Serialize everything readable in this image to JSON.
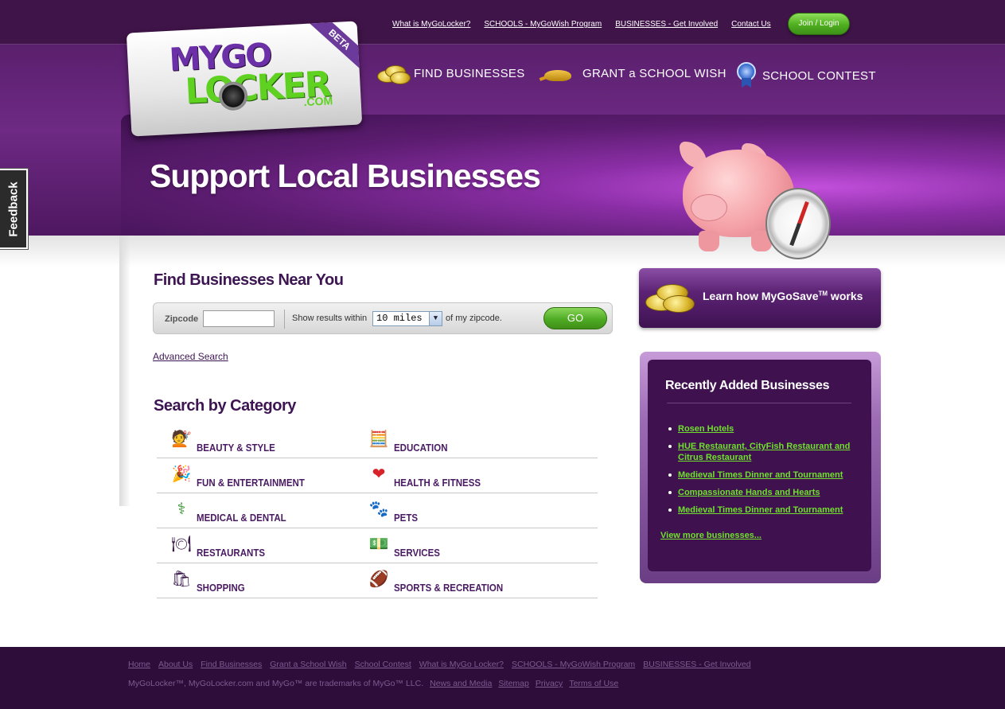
{
  "top_links": [
    "What is MyGoLocker?",
    "SCHOOLS - MyGoWish Program",
    "BUSINESSES - Get Involved",
    "Contact Us"
  ],
  "join_label": "Join / Login",
  "logo": {
    "line1": "MYGO",
    "line2": "LOCKER",
    "tld": ".COM",
    "badge": "BETA"
  },
  "main_nav": [
    {
      "label": "FIND BUSINESSES",
      "icon": "gold-coins-icon"
    },
    {
      "label": "GRANT a SCHOOL WISH",
      "icon": "magic-lamp-icon"
    },
    {
      "label": "SCHOOL CONTEST",
      "icon": "award-ribbon-icon"
    }
  ],
  "hero_title": "Support Local Businesses",
  "feedback_label": "Feedback",
  "search": {
    "heading": "Find Businesses Near You",
    "zip_label": "Zipcode",
    "zip_value": "",
    "within_label": "Show results within",
    "miles_selected": "10 miles",
    "zip_suffix": "of my zipcode.",
    "go_label": "GO",
    "advanced_label": "Advanced Search"
  },
  "category_heading": "Search by Category",
  "categories": [
    {
      "label": "BEAUTY & STYLE",
      "icon": "hair-dryer-icon",
      "glyph": "💇"
    },
    {
      "label": "EDUCATION",
      "icon": "chalkboard-icon",
      "glyph": "🧮"
    },
    {
      "label": "FUN & ENTERTAINMENT",
      "icon": "fireworks-icon",
      "glyph": "🎉"
    },
    {
      "label": "HEALTH & FITNESS",
      "icon": "heart-monitor-icon",
      "glyph": "❤"
    },
    {
      "label": "MEDICAL & DENTAL",
      "icon": "caduceus-icon",
      "glyph": "⚕"
    },
    {
      "label": "PETS",
      "icon": "pet-bowl-icon",
      "glyph": "🐾"
    },
    {
      "label": "RESTAURANTS",
      "icon": "plate-fork-icon",
      "glyph": "🍽"
    },
    {
      "label": "SERVICES",
      "icon": "money-icon",
      "glyph": "💵"
    },
    {
      "label": "SHOPPING",
      "icon": "shopping-bags-icon",
      "glyph": "🛍"
    },
    {
      "label": "SPORTS & RECREATION",
      "icon": "football-icon",
      "glyph": "🏈"
    }
  ],
  "learn_box": {
    "text_before": "Learn how MyGoSave",
    "tm": "TM",
    "text_after": " works"
  },
  "recent": {
    "title": "Recently Added Businesses",
    "items": [
      "Rosen Hotels",
      "HUE Restaurant, CityFish Restaurant and Citrus Restaurant",
      "Medieval Times Dinner and Tournament",
      "Compassionate Hands and Hearts",
      "Medieval Times Dinner and Tournament"
    ],
    "view_more": "View more businesses..."
  },
  "footer": {
    "links": [
      "Home",
      "About Us",
      "Find Businesses",
      "Grant a School Wish",
      "School Contest",
      "What is MyGo Locker?",
      "SCHOOLS - MyGoWish Program",
      "BUSINESSES - Get Involved"
    ],
    "legal_text": "MyGoLocker™, MyGoLocker.com and MyGo™ are trademarks of MyGo™ LLC.",
    "legal_links": [
      "News and Media",
      "Sitemap",
      "Privacy",
      "Terms of Use"
    ]
  },
  "colors": {
    "brand_purple": "#5a1f6d",
    "accent_green": "#5fd121",
    "footer_bg": "#2e0d3a"
  }
}
